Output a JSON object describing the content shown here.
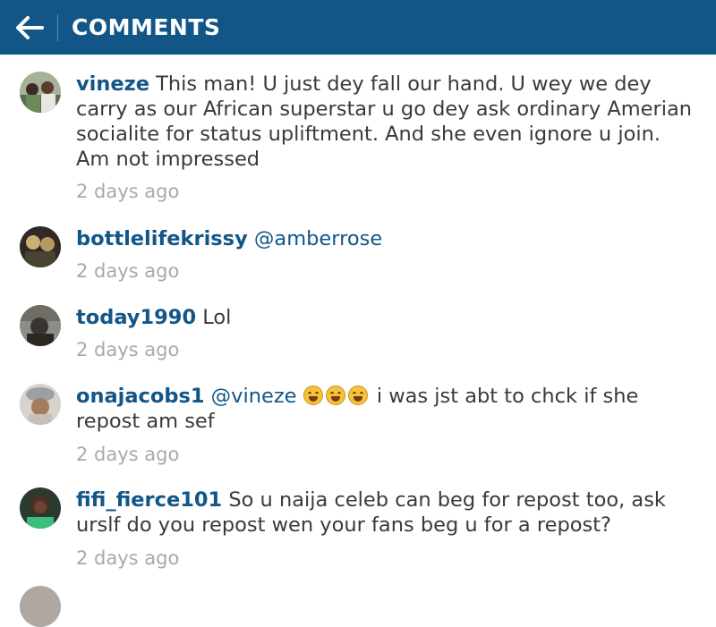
{
  "header": {
    "title": "COMMENTS",
    "background": "#125688",
    "back_icon": "arrow-left-icon"
  },
  "comments": [
    {
      "username": "vineze",
      "text": "This man! U just dey fall our hand. U wey we dey carry as our African superstar u go dey ask ordinary Amerian socialite for status upliftment. And she even ignore u join. Am not impressed",
      "time": "2 days ago"
    },
    {
      "username": "bottlelifekrissy",
      "mention": "@amberrose",
      "time": "2 days ago"
    },
    {
      "username": "today1990",
      "text": "Lol",
      "time": "2 days ago"
    },
    {
      "username": "onajacobs1",
      "mention": "@vineze",
      "emoji_icon": "face-with-tears-of-joy-icon",
      "text": "i was jst abt to chck if she repost am sef",
      "time": "2 days ago"
    },
    {
      "username": "fifi_fierce101",
      "text": "So u naija celeb can beg for repost too, ask urslf do you repost wen your fans beg u for a repost?",
      "time": "2 days ago"
    }
  ],
  "colors": {
    "username": "#125688",
    "timestamp": "#a9a9a9",
    "text": "#3a3a3a"
  }
}
